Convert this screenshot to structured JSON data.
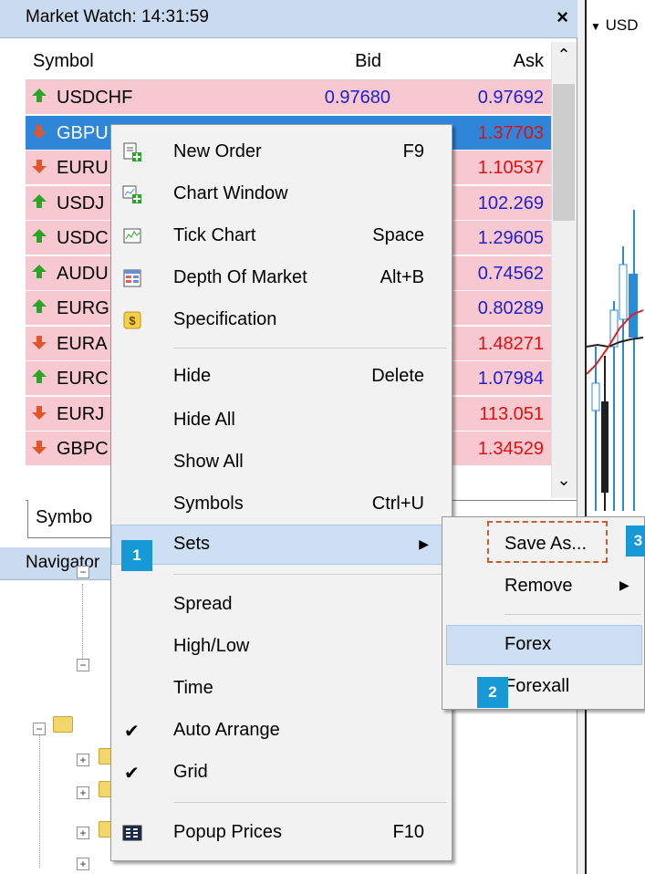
{
  "market_watch": {
    "title": "Market Watch: 14:31:59",
    "close_label": "×",
    "columns": {
      "symbol": "Symbol",
      "bid": "Bid",
      "ask": "Ask"
    },
    "rows": [
      {
        "symbol": "USDCHF",
        "bid": "0.97680",
        "ask": "0.97692",
        "dir": "up"
      },
      {
        "symbol": "GBPU",
        "bid": "",
        "ask": "1.37703",
        "dir": "down"
      },
      {
        "symbol": "EURU",
        "bid": "",
        "ask": "1.10537",
        "dir": "down"
      },
      {
        "symbol": "USDJ",
        "bid": "",
        "ask": "102.269",
        "dir": "up"
      },
      {
        "symbol": "USDC",
        "bid": "",
        "ask": "1.29605",
        "dir": "up"
      },
      {
        "symbol": "AUDU",
        "bid": "",
        "ask": "0.74562",
        "dir": "up"
      },
      {
        "symbol": "EURG",
        "bid": "",
        "ask": "0.80289",
        "dir": "up"
      },
      {
        "symbol": "EURA",
        "bid": "",
        "ask": "1.48271",
        "dir": "down"
      },
      {
        "symbol": "EURC",
        "bid": "",
        "ask": "1.07984",
        "dir": "up"
      },
      {
        "symbol": "EURJ",
        "bid": "",
        "ask": "113.051",
        "dir": "down"
      },
      {
        "symbol": "GBPC",
        "bid": "",
        "ask": "1.34529",
        "dir": "down"
      }
    ],
    "tab_label": "Symbo"
  },
  "navigator": {
    "title": "Navigator"
  },
  "chart": {
    "tab_label": "USD"
  },
  "context_menu": {
    "items": [
      {
        "label": "New Order",
        "shortcut": "F9"
      },
      {
        "label": "Chart Window",
        "shortcut": ""
      },
      {
        "label": "Tick Chart",
        "shortcut": "Space"
      },
      {
        "label": "Depth Of Market",
        "shortcut": "Alt+B"
      },
      {
        "label": "Specification",
        "shortcut": ""
      },
      {
        "label": "Hide",
        "shortcut": "Delete"
      },
      {
        "label": "Hide All",
        "shortcut": ""
      },
      {
        "label": "Show All",
        "shortcut": ""
      },
      {
        "label": "Symbols",
        "shortcut": "Ctrl+U"
      },
      {
        "label": "Sets",
        "shortcut": ""
      },
      {
        "label": "Spread",
        "shortcut": ""
      },
      {
        "label": "High/Low",
        "shortcut": ""
      },
      {
        "label": "Time",
        "shortcut": ""
      },
      {
        "label": "Auto Arrange",
        "shortcut": ""
      },
      {
        "label": "Grid",
        "shortcut": ""
      },
      {
        "label": "Popup Prices",
        "shortcut": "F10"
      }
    ],
    "check_mark": "✔",
    "submenu_arrow": "▶"
  },
  "sets_submenu": {
    "items": [
      {
        "label": "Save As..."
      },
      {
        "label": "Remove"
      },
      {
        "label": "Forex"
      },
      {
        "label": "Forexall"
      }
    ]
  },
  "badges": [
    "1",
    "2",
    "3"
  ],
  "colors": {
    "row_bg": "#f8c8d0",
    "row_selected_bg": "#2f86d8",
    "up_arrow": "#2aa52a",
    "down_arrow": "#e0562a",
    "bid_blue": "#1f1fd0",
    "ask_red": "#e01010",
    "badge": "#1799d5"
  }
}
